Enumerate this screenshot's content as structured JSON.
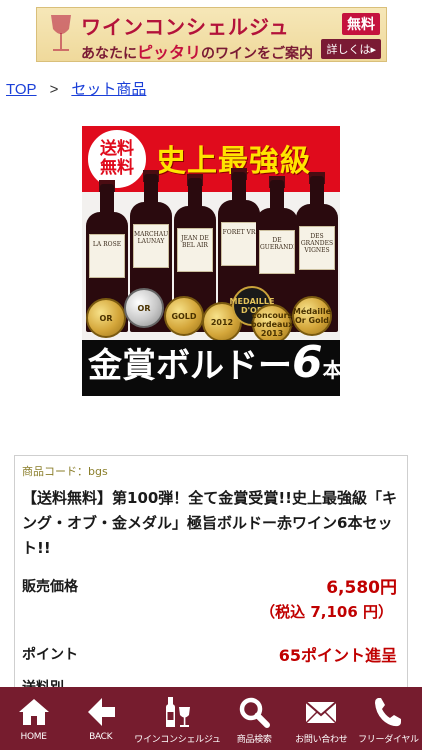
{
  "banner": {
    "line1": "ワインコンシェルジュ",
    "free_tag": "無料",
    "line2_prefix": "あなたに",
    "line2_highlight": "ピッタリ",
    "line2_suffix": "のワインをご案内",
    "detail_button": "詳しくは▸"
  },
  "breadcrumb": {
    "top": "TOP",
    "separator": ">",
    "category": "セット商品"
  },
  "product_image": {
    "shipping_badge": "送料無料",
    "headline": "史上最強級",
    "bottle_labels": [
      "LA ROSE",
      "MARCHAU-LAUNAY",
      "JEAN DE BEL AIR",
      "FORET VR",
      "DE GUERANDE",
      "DES GRANDES VIGNES"
    ],
    "medal_texts": [
      "OR",
      "OR",
      "GOLD",
      "2012",
      "MEDAILLE D'OR",
      "concours bordeaux 2013",
      "Médaille Or Gold"
    ],
    "award_text": "金賞ボルドー",
    "award_number": "6",
    "award_unit": "本"
  },
  "product": {
    "code": "商品コード：bgs",
    "title": "【送料無料】第100弾！全て金賞受賞!!史上最強級「キング・オブ・金メダル」極旨ボルドー赤ワイン6本セット!!",
    "price_label": "販売価格",
    "price": "6,580円",
    "price_with_tax": "（税込 7,106 円）",
    "point_label": "ポイント",
    "points": "65ポイント進呈",
    "shipping_label": "送料別"
  },
  "nav": {
    "items": [
      {
        "label": "HOME",
        "icon": "home-icon"
      },
      {
        "label": "BACK",
        "icon": "back-arrow-icon"
      },
      {
        "label": "ワインコンシェルジュ",
        "icon": "wine-bottle-glass-icon"
      },
      {
        "label": "商品検索",
        "icon": "search-icon"
      },
      {
        "label": "お問い合わせ",
        "icon": "mail-icon"
      },
      {
        "label": "フリーダイヤル",
        "icon": "phone-icon"
      }
    ]
  },
  "colors": {
    "nav_bg": "#761c2e",
    "price_red": "#c00000",
    "link_blue": "#1a3fd8",
    "banner_bg": "#efd99b"
  }
}
